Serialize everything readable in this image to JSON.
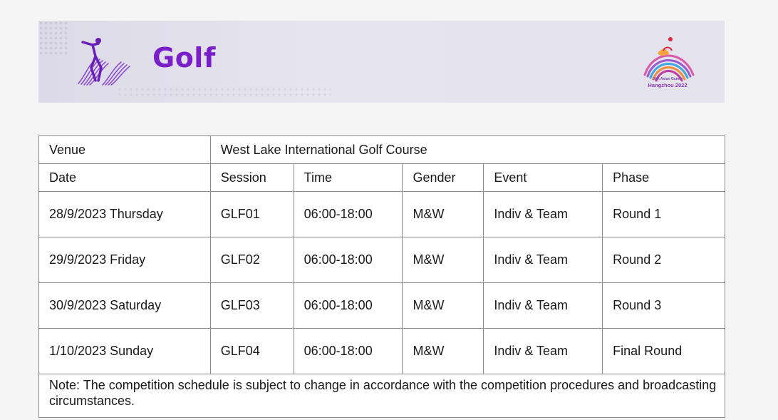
{
  "banner": {
    "sport": "Golf",
    "emblem_line1": "19th Asian Games",
    "emblem_line2": "Hangzhou 2022",
    "accent_color": "#7a1fc8"
  },
  "table": {
    "venue_label": "Venue",
    "venue_value": "West Lake International Golf Course",
    "headers": [
      "Date",
      "Session",
      "Time",
      "Gender",
      "Event",
      "Phase"
    ],
    "rows": [
      {
        "date": "28/9/2023 Thursday",
        "session": "GLF01",
        "time": "06:00-18:00",
        "gender": "M&W",
        "event": "Indiv & Team",
        "phase": "Round 1"
      },
      {
        "date": "29/9/2023 Friday",
        "session": "GLF02",
        "time": "06:00-18:00",
        "gender": "M&W",
        "event": "Indiv & Team",
        "phase": "Round 2"
      },
      {
        "date": "30/9/2023 Saturday",
        "session": "GLF03",
        "time": "06:00-18:00",
        "gender": "M&W",
        "event": "Indiv & Team",
        "phase": "Round 3"
      },
      {
        "date": "1/10/2023 Sunday",
        "session": "GLF04",
        "time": "06:00-18:00",
        "gender": "M&W",
        "event": "Indiv & Team",
        "phase": "Final Round"
      }
    ],
    "note": "Note: The competition schedule is subject to change in accordance with the competition procedures and broadcasting circumstances."
  }
}
